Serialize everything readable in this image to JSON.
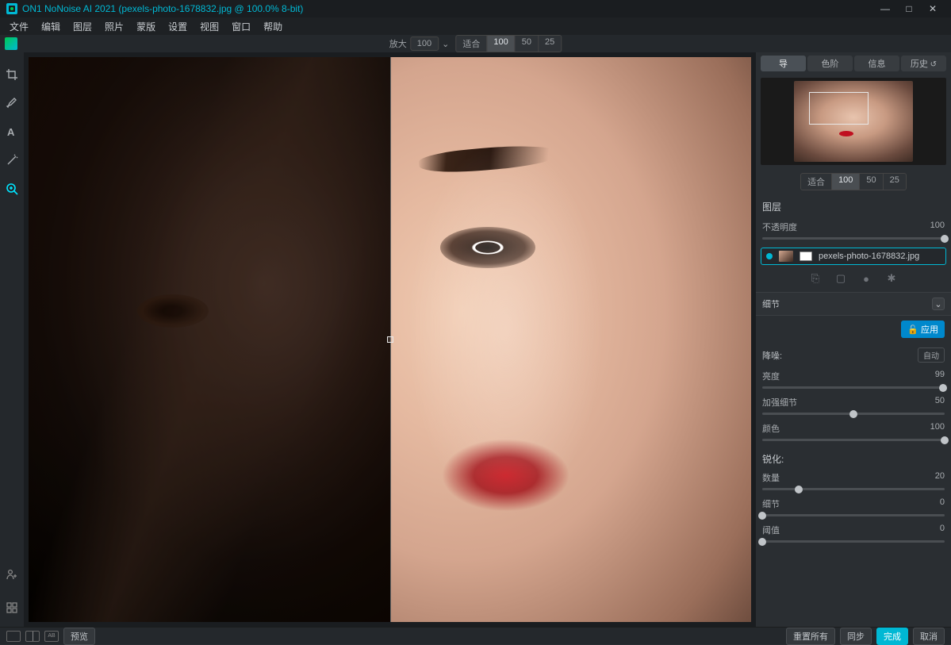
{
  "titlebar": {
    "title": "ON1 NoNoise AI 2021 (pexels-photo-1678832.jpg @ 100.0% 8-bit)"
  },
  "menu": {
    "file": "文件",
    "edit": "编辑",
    "layer": "图层",
    "photo": "照片",
    "mask": "蒙版",
    "settings": "设置",
    "view": "视图",
    "window": "窗口",
    "help": "帮助"
  },
  "zoom": {
    "label": "放大",
    "value": "100",
    "down": "⌄"
  },
  "fit": {
    "fit_label": "适合",
    "z100": "100",
    "z50": "50",
    "z25": "25"
  },
  "tabs": {
    "nav": "导",
    "histogram": "色阶",
    "info": "信息",
    "history": "历史"
  },
  "nav_zoom": {
    "fit": "适合",
    "z100": "100",
    "z50": "50",
    "z25": "25"
  },
  "layers": {
    "title": "图层",
    "opacity_label": "不透明度",
    "opacity_value": "100",
    "filename": "pexels-photo-1678832.jpg"
  },
  "detail": {
    "title": "细节",
    "apply": "应用"
  },
  "noise": {
    "title": "降噪:",
    "auto": "自动",
    "luminance_label": "亮度",
    "luminance_value": "99",
    "enhance_label": "加强细节",
    "enhance_value": "50",
    "color_label": "颜色",
    "color_value": "100"
  },
  "sharpen": {
    "title": "锐化:",
    "amount_label": "数量",
    "amount_value": "20",
    "detail_label": "细节",
    "detail_value": "0",
    "threshold_label": "阈值",
    "threshold_value": "0"
  },
  "bottom": {
    "preview": "预览",
    "reset": "重置所有",
    "sync": "同步",
    "done": "完成",
    "cancel": "取消"
  }
}
